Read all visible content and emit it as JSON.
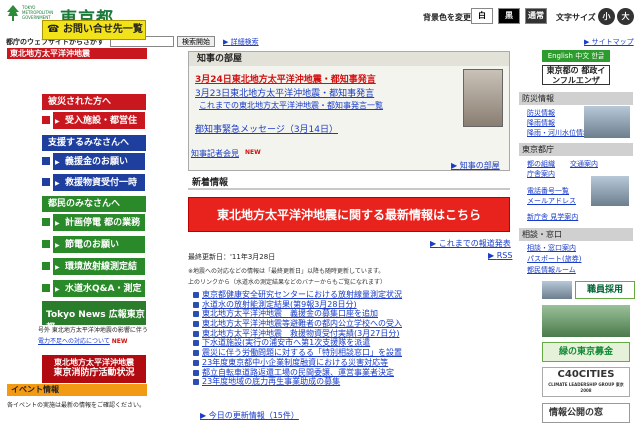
{
  "header": {
    "logo_small": "TOKYO METROPOLITAN GOVERNMENT",
    "logo_big": "東京都",
    "bg_label": "背景色を変更",
    "bg_buttons": [
      "白",
      "黒",
      "通常"
    ],
    "fs_label": "文字サイズ",
    "fs_buttons": [
      "小",
      "大"
    ]
  },
  "search": {
    "label": "都庁のウェブサイトからさがす",
    "value": "",
    "button": "検索開始",
    "detail": "詳細検索",
    "sitemap": "サイトマップ"
  },
  "left": {
    "quake_head": "東北地方太平洋沖地震",
    "contact": "お問い合せ先一覧",
    "victims_head": "被災された方へ",
    "victims_items": [
      "受入施設・都営住宅等"
    ],
    "support_head": "支援するみなさんへ",
    "support_items": [
      "義援金のお願い",
      "救援物資受付一時中止"
    ],
    "citizens_head": "都民のみなさんへ",
    "citizens_items": [
      "計画停電 都の業務変更",
      "節電のお願い",
      "環境放射線測定結果",
      "水道水Q&A・測定結果"
    ],
    "news_badge": "Tokyo News 広報東京都",
    "note1": "号外 東北地方太平洋沖地震の影響に伴う",
    "note2": "電力不足への対応について",
    "note_new": "NEW",
    "red_banner_1": "東北地方太平洋沖地震",
    "red_banner_2": "東京消防庁活動状況",
    "event_head": "イベント情報",
    "event_note": "各イベントの実施は最新の情報をご確認ください。"
  },
  "governor": {
    "head": "知事の部屋",
    "links": [
      "3月24日東北地方太平洋沖地震・都知事発言",
      "3月23日東北地方太平洋沖地震・都知事発言",
      "これまでの東北地方太平洋沖地震・都知事発言一覧",
      "都知事緊急メッセージ（3月14日）"
    ],
    "press": "知事記者会見",
    "press_new": "NEW",
    "more": "知事の部屋"
  },
  "news": {
    "head": "新着情報",
    "banner": "東北地方太平洋沖地震に関する最新情報はこちら",
    "past": "これまでの報道発表",
    "rss": "RSS",
    "updated": "最終更新日：'11年3月28日",
    "notice1": "※地震への対応などの情報は「最終更新日」以降も随時更新しています。",
    "notice2": "上のリンクから（水道水の測定結果などのバナーからもご覧になれます）",
    "items": [
      "東京都健康安全研究センターにおける放射線量測定状況",
      "水道水の放射能測定結果(第9報3月28日分)",
      "東北地方太平洋沖地震　義援金の募集口座を追加",
      "東北地方太平洋沖地震等避難者の都内公立学校への受入",
      "東北地方太平洋沖地震　救援物資受付実績(3月27日分)",
      "下水道施設(実行の浦安市へ第1次支援隊を派遣",
      "震災に伴う労働問題に対するる「特別相談窓口」を設置",
      "23年度東京都中小企業制度融資における災害対応等",
      "都立自転車道路返還工場の民間委譲、運営事業者決定",
      "23年度地域の底力再生事業助成の募集"
    ],
    "today": "今日の更新情報（15件）"
  },
  "right": {
    "lang": "English 中文 한글",
    "infra": "東京都の 都政インフルエンザ",
    "disaster_head": "防災情報",
    "disaster_links": [
      "防災情報",
      "降雨情報",
      "降雨・河川水位情報"
    ],
    "office_head": "東京都庁",
    "office_links": [
      "都の組織",
      "交通案内",
      "庁舎案内",
      "電話番号一覧",
      "メールアドレス",
      "新庁舎 見学案内"
    ],
    "consult_head": "相談・窓口",
    "consult_links": [
      "相談・窓口案内",
      "パスポート(旅券)",
      "都民情報ルーム"
    ],
    "shokuin": "職員採用",
    "green": "緑の東京募金",
    "c40": "C40CITIES",
    "c40_sub": "CLIMATE LEADERSHIP GROUP 東京 2008",
    "disclosure": "情報公開の窓"
  }
}
